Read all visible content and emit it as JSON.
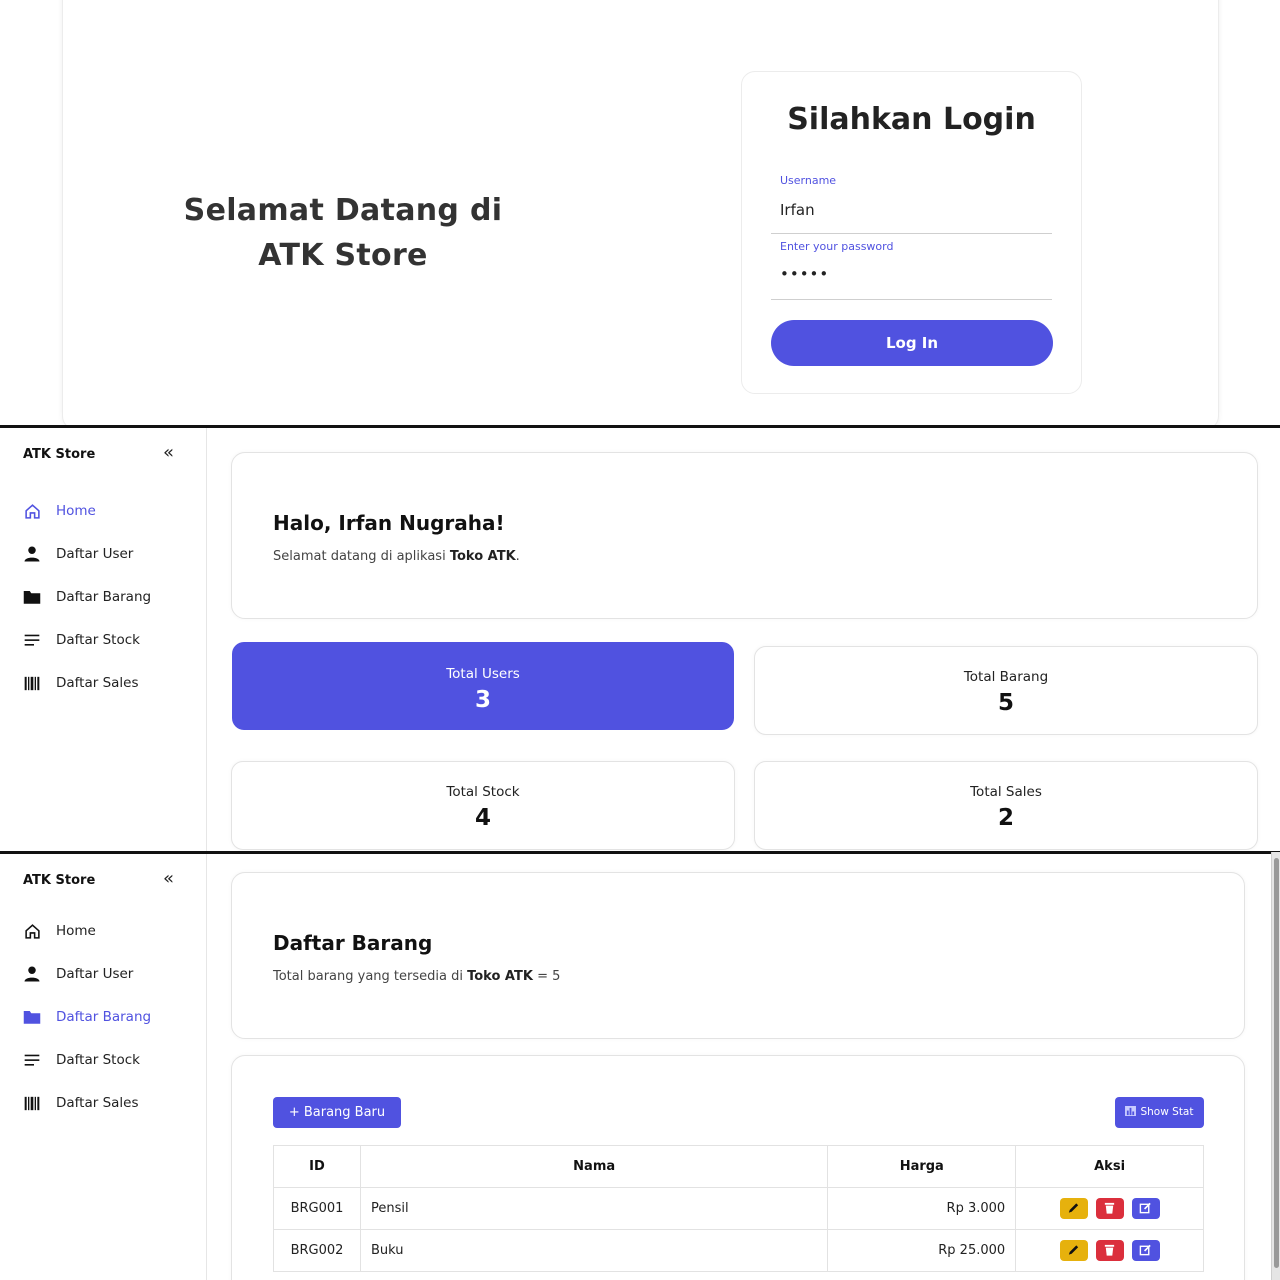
{
  "login": {
    "welcome_line1": "Selamat Datang di",
    "welcome_line2": "ATK Store",
    "title": "Silahkan Login",
    "username_label": "Username",
    "username_value": "Irfan",
    "password_label": "Enter your password",
    "password_value": "•••••",
    "submit_label": "Log In"
  },
  "sidebar": {
    "brand": "ATK Store",
    "collapse_icon": "«",
    "items": [
      {
        "label": "Home",
        "icon": "home-icon"
      },
      {
        "label": "Daftar User",
        "icon": "user-icon"
      },
      {
        "label": "Daftar Barang",
        "icon": "folder-icon"
      },
      {
        "label": "Daftar Stock",
        "icon": "list-icon"
      },
      {
        "label": "Daftar Sales",
        "icon": "barcode-icon"
      }
    ]
  },
  "dashboard": {
    "greeting": "Halo, Irfan Nugraha!",
    "subtitle_prefix": "Selamat datang di aplikasi ",
    "subtitle_bold": "Toko ATK",
    "subtitle_suffix": ".",
    "stats": [
      {
        "label": "Total Users",
        "value": "3"
      },
      {
        "label": "Total Barang",
        "value": "5"
      },
      {
        "label": "Total Stock",
        "value": "4"
      },
      {
        "label": "Total Sales",
        "value": "2"
      }
    ]
  },
  "barang": {
    "title": "Daftar Barang",
    "subtitle_prefix": "Total barang yang tersedia di ",
    "subtitle_bold": "Toko ATK",
    "subtitle_suffix": " = 5",
    "add_label": "+ Barang Baru",
    "stat_label": "Show Stat",
    "columns": [
      "ID",
      "Nama",
      "Harga",
      "Aksi"
    ],
    "rows": [
      {
        "id": "BRG001",
        "nama": "Pensil",
        "harga": "Rp 3.000"
      },
      {
        "id": "BRG002",
        "nama": "Buku",
        "harga": "Rp 25.000"
      }
    ]
  },
  "colors": {
    "accent": "#5052e0",
    "warning": "#e6b10d",
    "danger": "#db2f3c"
  }
}
